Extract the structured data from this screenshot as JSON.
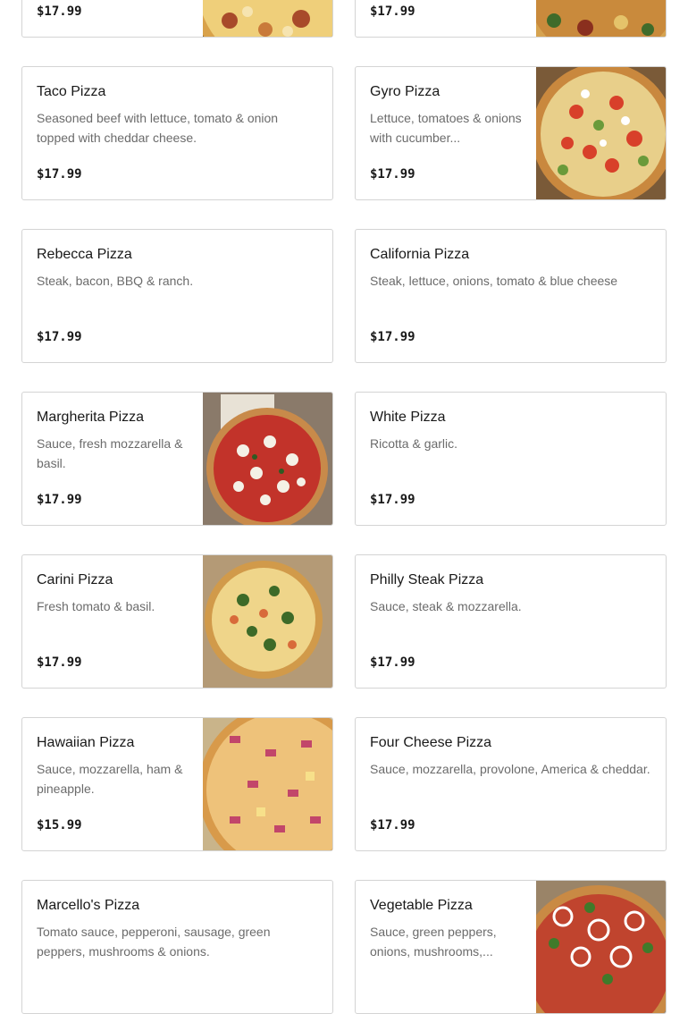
{
  "menu": {
    "items": [
      {
        "id": "item-top-left",
        "name": "",
        "description": "",
        "price": "$17.99",
        "has_image": true,
        "image": "pizza-photo"
      },
      {
        "id": "item-top-right",
        "name": "",
        "description": "",
        "price": "$17.99",
        "has_image": true,
        "image": "pizza-photo"
      },
      {
        "id": "taco-pizza",
        "name": "Taco Pizza",
        "description": "Seasoned beef with lettuce, tomato & onion topped with cheddar cheese.",
        "price": "$17.99",
        "has_image": false
      },
      {
        "id": "gyro-pizza",
        "name": "Gyro Pizza",
        "description": "Lettuce, tomatoes & onions with cucumber...",
        "price": "$17.99",
        "has_image": true,
        "image": "gyro-pizza-photo"
      },
      {
        "id": "rebecca-pizza",
        "name": "Rebecca Pizza",
        "description": "Steak, bacon, BBQ & ranch.",
        "price": "$17.99",
        "has_image": false
      },
      {
        "id": "california-pizza",
        "name": "California Pizza",
        "description": "Steak, lettuce, onions, tomato & blue cheese",
        "price": "$17.99",
        "has_image": false
      },
      {
        "id": "margherita-pizza",
        "name": "Margherita Pizza",
        "description": "Sauce, fresh mozzarella & basil.",
        "price": "$17.99",
        "has_image": true,
        "image": "margherita-pizza-photo"
      },
      {
        "id": "white-pizza",
        "name": "White Pizza",
        "description": "Ricotta & garlic.",
        "price": "$17.99",
        "has_image": false
      },
      {
        "id": "carini-pizza",
        "name": "Carini Pizza",
        "description": "Fresh tomato & basil.",
        "price": "$17.99",
        "has_image": true,
        "image": "carini-pizza-photo"
      },
      {
        "id": "philly-steak-pizza",
        "name": "Philly Steak Pizza",
        "description": "Sauce, steak & mozzarella.",
        "price": "$17.99",
        "has_image": false
      },
      {
        "id": "hawaiian-pizza",
        "name": "Hawaiian Pizza",
        "description": "Sauce, mozzarella, ham & pineapple.",
        "price": "$15.99",
        "has_image": true,
        "image": "hawaiian-pizza-photo"
      },
      {
        "id": "four-cheese-pizza",
        "name": "Four Cheese Pizza",
        "description": "Sauce, mozzarella, provolone, America & cheddar.",
        "price": "$17.99",
        "has_image": false
      },
      {
        "id": "marcellos-pizza",
        "name": "Marcello's Pizza",
        "description": "Tomato sauce, pepperoni, sausage, green peppers, mushrooms & onions.",
        "price": "",
        "has_image": false
      },
      {
        "id": "vegetable-pizza",
        "name": "Vegetable Pizza",
        "description": "Sauce, green peppers, onions, mushrooms,...",
        "price": "",
        "has_image": true,
        "image": "vegetable-pizza-photo"
      }
    ]
  },
  "colors": {
    "border": "#d4d4d4",
    "text": "#191919",
    "muted": "#6b6b6b",
    "background": "#ffffff"
  }
}
